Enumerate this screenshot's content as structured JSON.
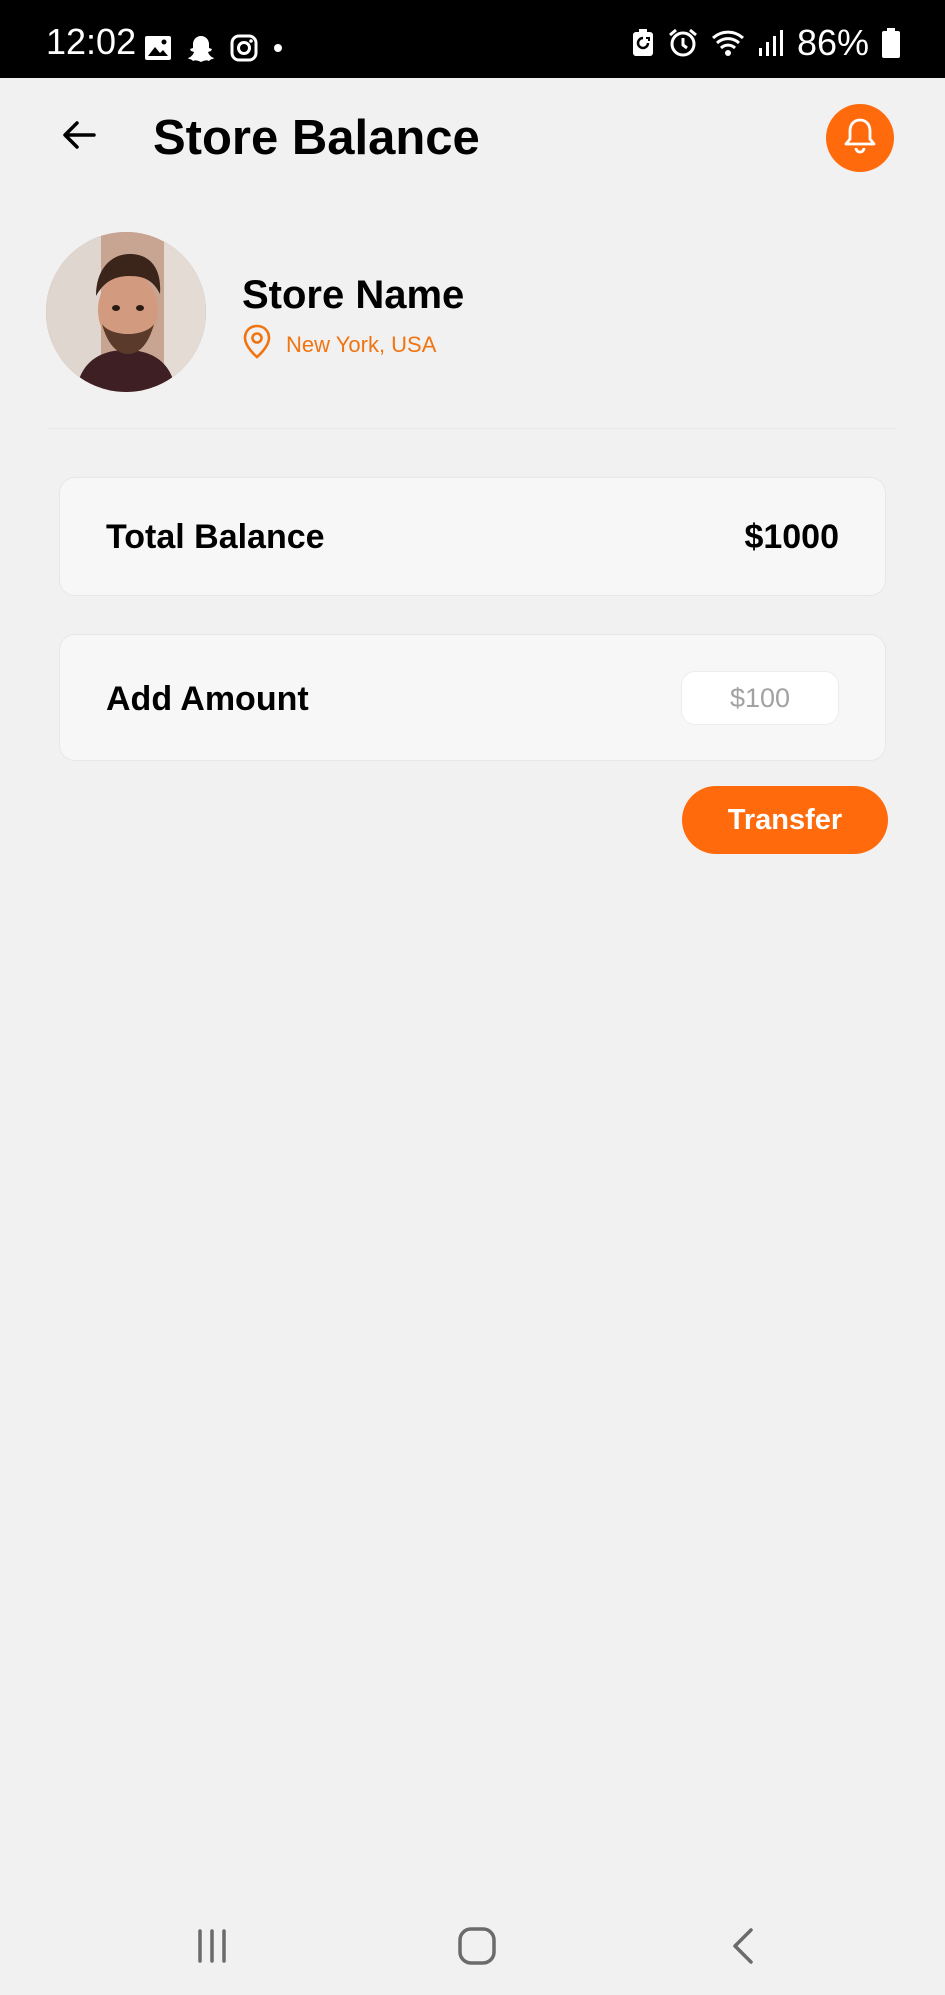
{
  "status_bar": {
    "time": "12:02",
    "battery_text": "86%",
    "left_icons": [
      "gallery-icon",
      "snapchat-icon",
      "instagram-icon",
      "dot-icon"
    ],
    "right_icons": [
      "battery-saver-icon",
      "alarm-icon",
      "wifi-icon",
      "signal-icon",
      "battery-icon"
    ]
  },
  "header": {
    "title": "Store Balance",
    "back_icon": "arrow-left-icon",
    "notification_icon": "bell-icon"
  },
  "store": {
    "name": "Store Name",
    "location": "New York, USA",
    "location_icon": "map-pin-icon"
  },
  "balance_card": {
    "label": "Total Balance",
    "value": "$1000"
  },
  "amount_card": {
    "label": "Add Amount",
    "placeholder": "$100"
  },
  "actions": {
    "transfer_label": "Transfer"
  },
  "nav_bar": {
    "icons": [
      "recents-icon",
      "home-icon",
      "back-icon"
    ]
  },
  "colors": {
    "accent": "#ff6a0d",
    "location_text": "#f07512",
    "background": "#f2f1f1",
    "card": "#f7f7f7"
  }
}
